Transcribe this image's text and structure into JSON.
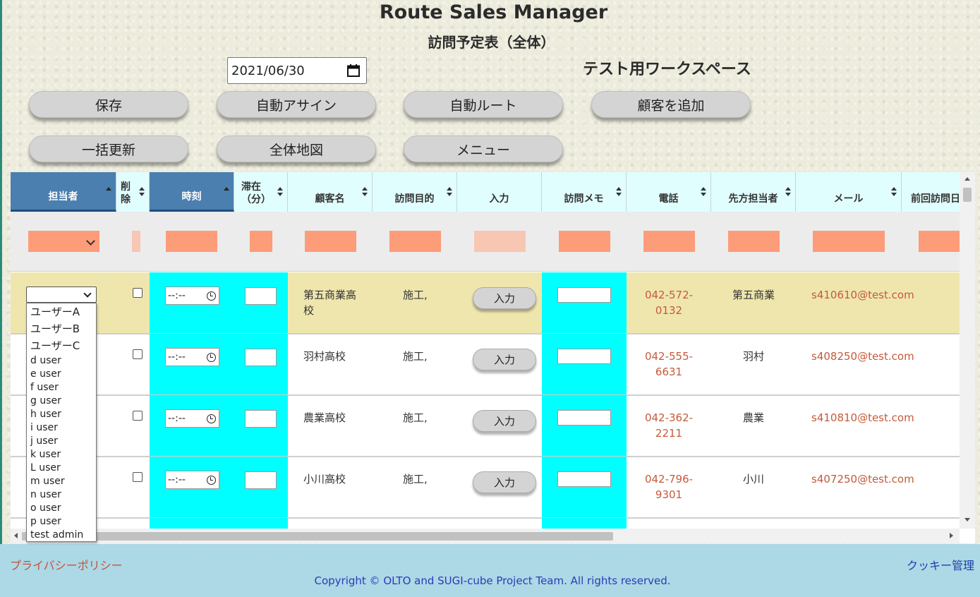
{
  "header": {
    "app_title": "Route Sales Manager",
    "subtitle": "訪問予定表（全体）",
    "workspace": "テスト用ワークスペース",
    "date_value": "2021/06/30"
  },
  "buttons": {
    "save": "保存",
    "auto_assign": "自動アサイン",
    "auto_route": "自動ルート",
    "add_customer": "顧客を追加",
    "bulk_update": "一括更新",
    "full_map": "全体地図",
    "menu": "メニュー"
  },
  "columns": {
    "assignee": "担当者",
    "delete_l1": "削",
    "delete_l2": "除",
    "time": "時刻",
    "stay_l1": "滞在",
    "stay_l2": "（分）",
    "customer": "顧客名",
    "purpose": "訪問目的",
    "input": "入力",
    "memo": "訪問メモ",
    "phone": "電話",
    "contact": "先方担当者",
    "email": "メール",
    "last_visit": "前回訪問日"
  },
  "time_placeholder": "--:--",
  "input_button_label": "入力",
  "rows": [
    {
      "customer_l1": "第五商業高",
      "customer_l2": "校",
      "purpose": "施工,",
      "phone_l1": "042-572-",
      "phone_l2": "0132",
      "contact": "第五商業",
      "email": "s410610@test.com"
    },
    {
      "customer_l1": "羽村高校",
      "customer_l2": "",
      "purpose": "施工,",
      "phone_l1": "042-555-",
      "phone_l2": "6631",
      "contact": "羽村",
      "email": "s408250@test.com"
    },
    {
      "customer_l1": "農業高校",
      "customer_l2": "",
      "purpose": "施工,",
      "phone_l1": "042-362-",
      "phone_l2": "2211",
      "contact": "農業",
      "email": "s410810@test.com"
    },
    {
      "customer_l1": "小川高校",
      "customer_l2": "",
      "purpose": "施工,",
      "phone_l1": "042-796-",
      "phone_l2": "9301",
      "contact": "小川",
      "email": "s407250@test.com"
    }
  ],
  "assignee_options": [
    "ユーザーA",
    "ユーザーB",
    "ユーザーC",
    "d user",
    "e user",
    "f user",
    "g user",
    "h user",
    "i user",
    "j user",
    "k user",
    "L user",
    "m user",
    "n user",
    "o user",
    "p user",
    "test admin"
  ],
  "footer": {
    "privacy": "プライバシーポリシー",
    "cookie": "クッキー管理",
    "copyright": "Copyright © OLTO and SUGI-cube Project Team. All rights reserved."
  },
  "colors": {
    "header_dark": "#4a7faf",
    "header_light": "#e1fefe",
    "filter_box": "#fd9c78",
    "selected_row": "#efe6ae",
    "cyan_column": "#00ffff",
    "footer_bg": "#add8e6",
    "link_red": "#c0553a"
  },
  "icons": [
    "calendar-icon",
    "clock-icon",
    "sort-icon",
    "chevron-down-icon"
  ]
}
